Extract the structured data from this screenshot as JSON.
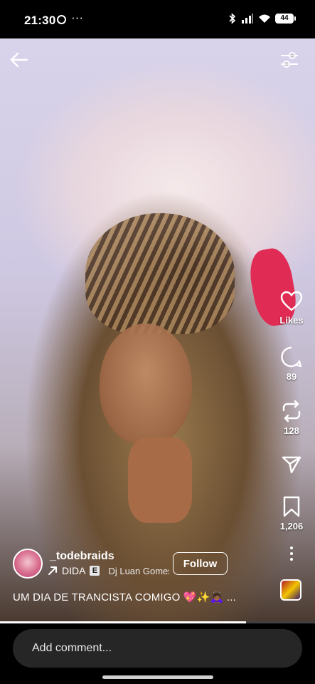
{
  "status_bar": {
    "time": "21:30",
    "battery": "44"
  },
  "reel": {
    "username": "_todebraids",
    "audio": {
      "title": "DIDA",
      "explicit_badge": "E",
      "artist": "Dj Luan Gomes"
    },
    "follow_label": "Follow",
    "caption": "UM DIA DE TRANCISTA COMIGO 💖✨🙇🏾‍♀️ ...",
    "progress_fraction": 0.78
  },
  "actions": {
    "likes_label": "Likes",
    "comments_count": "89",
    "reposts_count": "128",
    "saves_count": "1,206"
  },
  "comment_bar": {
    "placeholder": "Add comment..."
  },
  "icons": [
    "back-arrow-icon",
    "filter-icon",
    "heart-icon",
    "comment-icon",
    "repost-icon",
    "share-icon",
    "bookmark-icon",
    "more-icon",
    "music-icon",
    "whatsapp-icon",
    "bluetooth-icon",
    "signal-icon",
    "wifi-icon",
    "battery-icon"
  ],
  "colors": {
    "background": "#000000",
    "accent": "#ffffff",
    "input_bg": "#262626"
  }
}
